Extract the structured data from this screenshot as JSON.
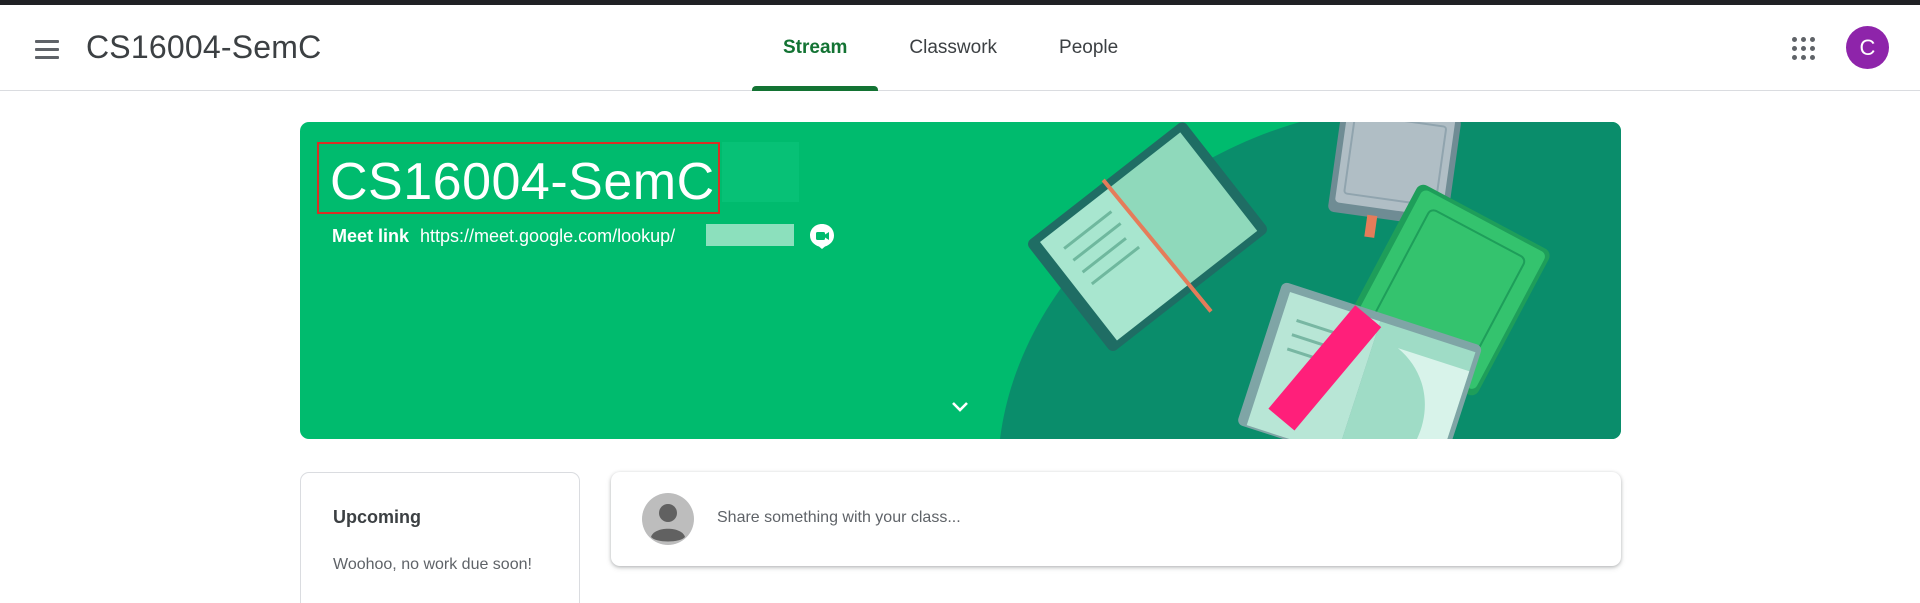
{
  "header": {
    "menu_icon": "hamburger-menu-icon",
    "title": "CS16004-SemC",
    "tabs": [
      {
        "label": "Stream",
        "active": true
      },
      {
        "label": "Classwork",
        "active": false
      },
      {
        "label": "People",
        "active": false
      }
    ],
    "apps_icon": "google-apps-grid-icon",
    "account_initial": "C"
  },
  "banner": {
    "class_name": "CS16004-SemC",
    "meet_label": "Meet link",
    "meet_url": "https://meet.google.com/lookup/",
    "meet_icon": "google-meet-icon",
    "expand_icon": "chevron-down-icon"
  },
  "upcoming": {
    "title": "Upcoming",
    "message": "Woohoo, no work due soon!"
  },
  "share": {
    "placeholder": "Share something with your class..."
  },
  "colors": {
    "brand_green": "#137333",
    "banner_green": "#00bb6e",
    "avatar_purple": "#8e24aa",
    "highlight_red": "#d93025"
  }
}
